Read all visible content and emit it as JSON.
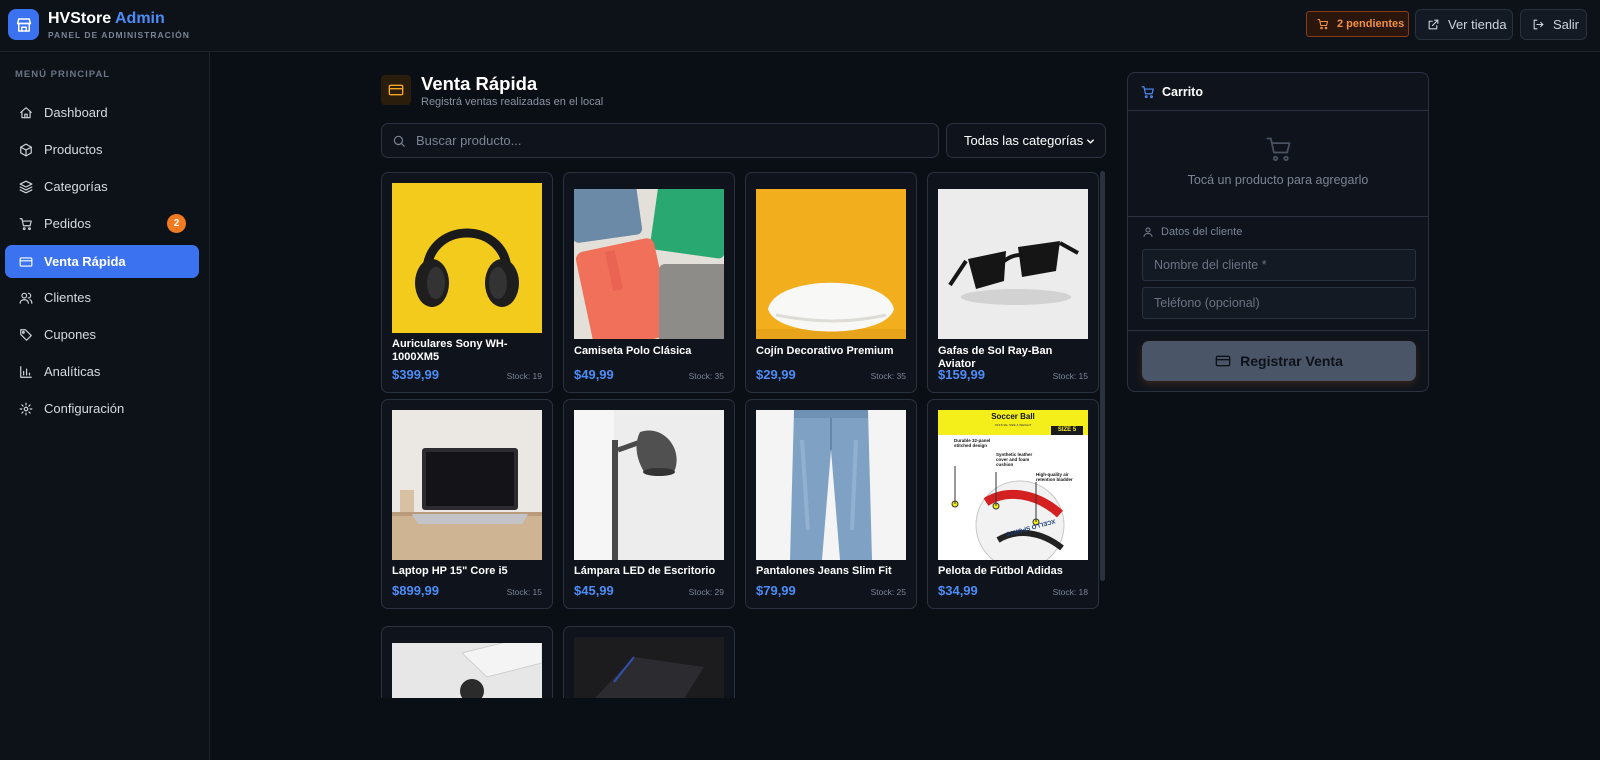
{
  "header": {
    "brand_name": "HVStore",
    "brand_accent": "Admin",
    "brand_subtitle": "PANEL DE ADMINISTRACIÓN",
    "pending_label": "2 pendientes",
    "view_store_label": "Ver tienda",
    "logout_label": "Salir"
  },
  "sidebar": {
    "menu_title": "MENÚ PRINCIPAL",
    "items": [
      {
        "label": "Dashboard",
        "icon": "home-icon"
      },
      {
        "label": "Productos",
        "icon": "package-icon"
      },
      {
        "label": "Categorías",
        "icon": "layers-icon"
      },
      {
        "label": "Pedidos",
        "icon": "cart-icon",
        "badge": "2"
      },
      {
        "label": "Venta Rápida",
        "icon": "credit-card-icon",
        "active": true
      },
      {
        "label": "Clientes",
        "icon": "users-icon"
      },
      {
        "label": "Cupones",
        "icon": "tag-icon"
      },
      {
        "label": "Analíticas",
        "icon": "bar-chart-icon"
      },
      {
        "label": "Configuración",
        "icon": "gear-icon"
      }
    ]
  },
  "page": {
    "title": "Venta Rápida",
    "subtitle": "Registrá ventas realizadas en el local",
    "search_placeholder": "Buscar producto...",
    "category_selected": "Todas las categorías"
  },
  "products": [
    {
      "name": "Auriculares Sony WH-1000XM5",
      "price": "$399,99",
      "stock": "Stock: 19"
    },
    {
      "name": "Camiseta Polo Clásica",
      "price": "$49,99",
      "stock": "Stock: 35"
    },
    {
      "name": "Cojín Decorativo Premium",
      "price": "$29,99",
      "stock": "Stock: 35"
    },
    {
      "name": "Gafas de Sol Ray-Ban Aviator",
      "price": "$159,99",
      "stock": "Stock: 15"
    },
    {
      "name": "Laptop HP 15\" Core i5",
      "price": "$899,99",
      "stock": "Stock: 15"
    },
    {
      "name": "Lámpara LED de Escritorio",
      "price": "$45,99",
      "stock": "Stock: 29"
    },
    {
      "name": "Pantalones Jeans Slim Fit",
      "price": "$79,99",
      "stock": "Stock: 25"
    },
    {
      "name": "Pelota de Fútbol Adidas",
      "price": "$34,99",
      "stock": "Stock: 18"
    }
  ],
  "ball_image_text": {
    "title": "Soccer Ball",
    "subtitle": "OFFICIAL SIZE & WEIGHT",
    "size": "SIZE 5",
    "feature1": "Durable 32-panel stitched design",
    "feature2": "Synthetic leather cover and foam cushion",
    "feature3": "High-quality air retention bladder",
    "brand": "XCELLO SPORTS"
  },
  "cart": {
    "title": "Carrito",
    "empty_text": "Tocá un producto para agregarlo",
    "client_section": "Datos del cliente",
    "name_placeholder": "Nombre del cliente *",
    "phone_placeholder": "Teléfono (opcional)",
    "register_label": "Registrar Venta"
  },
  "colors": {
    "accent": "#3b72f0",
    "price": "#4d8cf7",
    "warning": "#f27a21",
    "background": "#0a0e15"
  }
}
